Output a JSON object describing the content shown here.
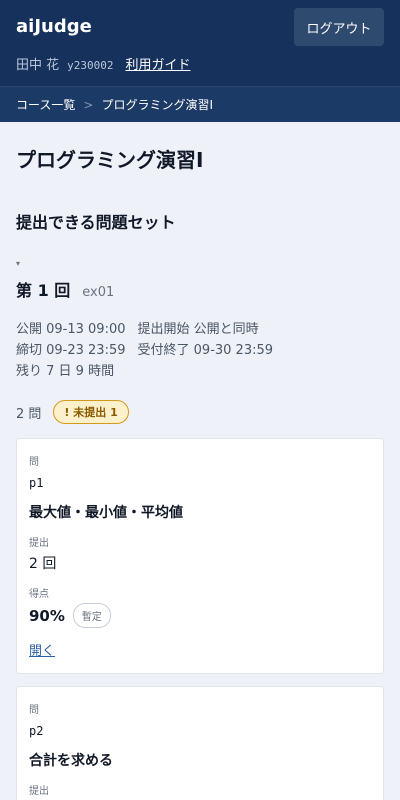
{
  "header": {
    "app_title": "aiJudge",
    "logout_label": "ログアウト",
    "user_name": "田中 花",
    "user_id": "y230002",
    "guide_label": "利用ガイド"
  },
  "breadcrumb": {
    "items": [
      "コース一覧",
      "プログラミング演習Ⅰ"
    ],
    "separator": ">"
  },
  "page_title": "プログラミング演習Ⅰ",
  "section_title": "提出できる問題セット",
  "round": {
    "collapse_glyph": "▾",
    "title": "第 1 回",
    "code": "ex01",
    "publish": "公開 09-13 09:00",
    "submit_start": "提出開始 公開と同時",
    "deadline": "締切 09-23 23:59",
    "accept_end": "受付終了 09-30 23:59",
    "remaining": "残り 7 日 9 時間",
    "problem_count": "2 問",
    "unsubmitted_badge": "! 未提出 1"
  },
  "problems": [
    {
      "label": "問",
      "id": "p1",
      "title": "最大値・最小値・平均値",
      "submit_label": "提出",
      "submit_count": "2 回",
      "score_label": "得点",
      "score": "90%",
      "score_status": "暫定",
      "open_label": "開く"
    },
    {
      "label": "問",
      "id": "p2",
      "title": "合計を求める",
      "submit_label": "提出"
    }
  ],
  "colors": {
    "header_bg": "#16325c",
    "breadcrumb_bg": "#1c3a66",
    "page_bg": "#eef1f8",
    "badge_border": "#d59a1a",
    "badge_bg": "#fdf1cc",
    "link": "#2b5fa6"
  }
}
